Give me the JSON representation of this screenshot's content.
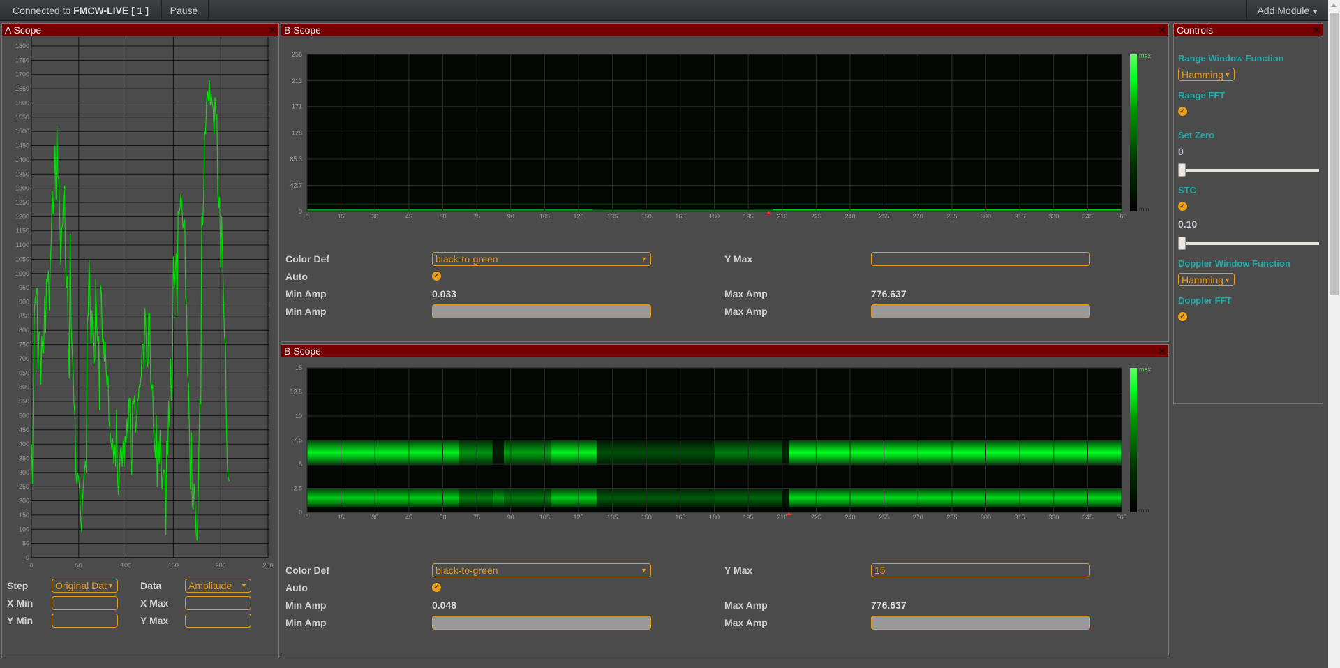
{
  "topbar": {
    "connected_prefix": "Connected to ",
    "device": "FMCW-LIVE [ 1 ]",
    "pause_label": "Pause",
    "add_module_label": "Add Module"
  },
  "colors": {
    "panel_header": "#760000",
    "accent": "#e89a16",
    "trace": "#00e000",
    "control_title": "#21a9a9"
  },
  "a_scope": {
    "title": "A Scope",
    "close_icon": "close-icon",
    "form": {
      "step_label": "Step",
      "step_value": "Original Dat",
      "data_label": "Data",
      "data_value": "Amplitude",
      "xmin_label": "X Min",
      "xmin_value": "",
      "xmax_label": "X Max",
      "xmax_value": "",
      "ymin_label": "Y Min",
      "ymin_value": "",
      "ymax_label": "Y Max",
      "ymax_value": ""
    }
  },
  "b_scope_1": {
    "title": "B Scope",
    "legend_max": "max",
    "legend_min": "min",
    "form": {
      "color_def_label": "Color Def",
      "color_def_value": "black-to-green",
      "y_max_label": "Y Max",
      "y_max_value": "",
      "auto_label": "Auto",
      "auto_checked": true,
      "min_amp_label": "Min Amp",
      "min_amp_value": "0.033",
      "max_amp_label": "Max Amp",
      "max_amp_value": "776.637",
      "min_amp_input_label": "Min Amp",
      "max_amp_input_label": "Max Amp"
    }
  },
  "b_scope_2": {
    "title": "B Scope",
    "legend_max": "max",
    "legend_min": "min",
    "form": {
      "color_def_label": "Color Def",
      "color_def_value": "black-to-green",
      "y_max_label": "Y Max",
      "y_max_value": "15",
      "auto_label": "Auto",
      "auto_checked": true,
      "min_amp_label": "Min Amp",
      "min_amp_value": "0.048",
      "max_amp_label": "Max Amp",
      "max_amp_value": "776.637",
      "min_amp_input_label": "Min Amp",
      "max_amp_input_label": "Max Amp"
    }
  },
  "controls": {
    "title": "Controls",
    "range_window_label": "Range Window Function",
    "range_window_value": "Hamming",
    "range_fft_label": "Range FFT",
    "range_fft_checked": true,
    "set_zero_label": "Set Zero",
    "set_zero_value": "0",
    "set_zero_fraction": 0.0,
    "stc_label": "STC",
    "stc_checked": true,
    "stc_value": "0.10",
    "stc_fraction": 0.0,
    "doppler_window_label": "Doppler Window Function",
    "doppler_window_value": "Hamming",
    "doppler_fft_label": "Doppler FFT",
    "doppler_fft_checked": true
  },
  "chart_data": [
    {
      "name": "a-scope",
      "type": "line",
      "title": "",
      "xlabel": "",
      "ylabel": "",
      "xlim": [
        0,
        250
      ],
      "ylim": [
        0,
        1800
      ],
      "x_ticks": [
        "0",
        "50",
        "100",
        "150",
        "200",
        "250"
      ],
      "y_ticks": [
        "0",
        "50",
        "100",
        "150",
        "200",
        "250",
        "300",
        "350",
        "400",
        "450",
        "500",
        "550",
        "600",
        "650",
        "700",
        "750",
        "800",
        "850",
        "900",
        "950",
        "1000",
        "1050",
        "1100",
        "1150",
        "1200",
        "1250",
        "1300",
        "1350",
        "1400",
        "1450",
        "1500",
        "1550",
        "1600",
        "1650",
        "1700",
        "1750",
        "1800"
      ],
      "grid": true,
      "series": [
        {
          "name": "Amplitude",
          "x": [
            0,
            1,
            2,
            3,
            4,
            5,
            6,
            7,
            8,
            9,
            10,
            11,
            12,
            13,
            14,
            15,
            16,
            17,
            18,
            19,
            20,
            21,
            22,
            23,
            24,
            25,
            26,
            27,
            28,
            29,
            30,
            31,
            32,
            33,
            34,
            35,
            36,
            37,
            38,
            39,
            40,
            41,
            42,
            43,
            44,
            45,
            46,
            47,
            48,
            49,
            50,
            51,
            52,
            53,
            54,
            55,
            56,
            57,
            58,
            59,
            60,
            61,
            62,
            63,
            64,
            65,
            66,
            67,
            68,
            69,
            70,
            71,
            72,
            73,
            74,
            75,
            76,
            77,
            78,
            79,
            80,
            81,
            82,
            83,
            84,
            85,
            86,
            87,
            88,
            89,
            90,
            91,
            92,
            93,
            94,
            95,
            96,
            97,
            98,
            99,
            100,
            101,
            102,
            103,
            104,
            105,
            106,
            107,
            108,
            109,
            110,
            111,
            112,
            113,
            114,
            115,
            116,
            117,
            118,
            119,
            120,
            121,
            122,
            123,
            124,
            125,
            126,
            127,
            128,
            129,
            130,
            131,
            132,
            133,
            134,
            135,
            136,
            137,
            138,
            139,
            140,
            141,
            142,
            143,
            144,
            145,
            146,
            147,
            148,
            149,
            150,
            151,
            152,
            153,
            154,
            155,
            156,
            157,
            158,
            159,
            160,
            161,
            162,
            163,
            164,
            165,
            166,
            167,
            168,
            169,
            170,
            171,
            172,
            173,
            174,
            175,
            176,
            177,
            178,
            179,
            180,
            181,
            182,
            183,
            184,
            185,
            186,
            187,
            188,
            189,
            190,
            191,
            192,
            193,
            194,
            195,
            196,
            197,
            198,
            199,
            200,
            201,
            202,
            203,
            204,
            205,
            206,
            207,
            208,
            209,
            210,
            211,
            212,
            213,
            214,
            215,
            216,
            217,
            218,
            219,
            220,
            221,
            222,
            223,
            224,
            225,
            226,
            227,
            228,
            229,
            230,
            231,
            232,
            233,
            234,
            235,
            236,
            237,
            238,
            239,
            240,
            241,
            242,
            243,
            244,
            245,
            246,
            247,
            248,
            249,
            250,
            251,
            252,
            253,
            254,
            255
          ],
          "y": [
            400,
            260,
            560,
            860,
            910,
            930,
            950,
            660,
            790,
            795,
            610,
            780,
            720,
            720,
            920,
            790,
            980,
            970,
            1010,
            870,
            1040,
            1120,
            1290,
            1210,
            1290,
            1450,
            1260,
            1520,
            1340,
            1330,
            1190,
            1030,
            1160,
            1170,
            1270,
            1310,
            1040,
            950,
            990,
            760,
            630,
            1140,
            820,
            730,
            670,
            540,
            500,
            300,
            260,
            300,
            280,
            230,
            150,
            90,
            200,
            260,
            300,
            340,
            300,
            820,
            860,
            1050,
            900,
            750,
            870,
            790,
            680,
            700,
            980,
            820,
            760,
            780,
            520,
            960,
            930,
            760,
            770,
            690,
            760,
            660,
            600,
            640,
            480,
            450,
            410,
            380,
            420,
            330,
            400,
            320,
            520,
            280,
            220,
            300,
            380,
            390,
            320,
            410,
            320,
            430,
            400,
            490,
            420,
            560,
            560,
            350,
            290,
            550,
            540,
            570,
            440,
            480,
            550,
            560,
            610,
            600,
            640,
            750,
            750,
            670,
            880,
            800,
            690,
            670,
            860,
            860,
            620,
            590,
            610,
            460,
            400,
            350,
            500,
            250,
            410,
            330,
            450,
            350,
            240,
            290,
            310,
            300,
            80,
            410,
            360,
            550,
            460,
            700,
            550,
            640,
            1060,
            950,
            1010,
            1070,
            850,
            1220,
            1210,
            1230,
            1280,
            1240,
            1160,
            1180,
            1190,
            920,
            880,
            650,
            610,
            440,
            240,
            440,
            180,
            170,
            260,
            190,
            90,
            60,
            170,
            400,
            560,
            540,
            1200,
            1170,
            1280,
            1500,
            1490,
            1600,
            1640,
            1610,
            1680,
            1590,
            1630,
            1600,
            1580,
            1490,
            1620,
            1540,
            1560,
            1280,
            1230,
            1270,
            1020,
            1200,
            1060,
            900,
            780,
            750,
            480,
            320,
            280,
            270
          ]
        }
      ]
    },
    {
      "name": "b-scope-range",
      "type": "heatmap",
      "title": "",
      "xlim": [
        0,
        360
      ],
      "ylim": [
        0,
        256
      ],
      "x_ticks": [
        "0",
        "15",
        "30",
        "45",
        "60",
        "75",
        "90",
        "105",
        "120",
        "135",
        "150",
        "165",
        "180",
        "195",
        "210",
        "225",
        "240",
        "255",
        "270",
        "285",
        "300",
        "315",
        "330",
        "345",
        "360"
      ],
      "y_ticks": [
        "0",
        "42.7",
        "85.3",
        "128",
        "171",
        "213",
        "256"
      ],
      "colormap": "black-to-green",
      "legend": [
        "max",
        "min"
      ],
      "marker_x": 204,
      "bands": [
        {
          "y": 3,
          "x_segments": [
            [
              0,
              126,
              0.7
            ],
            [
              126,
              206,
              0.2
            ],
            [
              206,
              360,
              0.95
            ]
          ]
        },
        {
          "y": 1,
          "x_segments": [
            [
              0,
              360,
              0.6
            ]
          ]
        },
        {
          "y": 12,
          "x_segments": [
            [
              0,
              360,
              0.15
            ]
          ]
        }
      ]
    },
    {
      "name": "b-scope-doppler",
      "type": "heatmap",
      "title": "",
      "xlim": [
        0,
        360
      ],
      "ylim": [
        0,
        15
      ],
      "x_ticks": [
        "0",
        "15",
        "30",
        "45",
        "60",
        "75",
        "90",
        "105",
        "120",
        "135",
        "150",
        "165",
        "180",
        "195",
        "210",
        "225",
        "240",
        "255",
        "270",
        "285",
        "300",
        "315",
        "330",
        "345",
        "360"
      ],
      "y_ticks": [
        "0",
        "2.5",
        "5",
        "7.5",
        "10",
        "12.5",
        "15"
      ],
      "colormap": "black-to-green",
      "legend": [
        "max",
        "min"
      ],
      "marker_x": 213,
      "bands": [
        {
          "y_center": 6.2,
          "y_halfwidth": 1.3,
          "x_segments": [
            [
              0,
              67,
              0.95
            ],
            [
              67,
              82,
              0.55
            ],
            [
              82,
              87,
              0.05
            ],
            [
              87,
              108,
              0.6
            ],
            [
              108,
              128,
              0.95
            ],
            [
              128,
              180,
              0.25
            ],
            [
              180,
              210,
              0.45
            ],
            [
              210,
              213,
              0.1
            ],
            [
              213,
              360,
              1.0
            ]
          ]
        },
        {
          "y_center": 1.5,
          "y_halfwidth": 1.0,
          "x_segments": [
            [
              0,
              67,
              0.8
            ],
            [
              67,
              82,
              0.45
            ],
            [
              82,
              87,
              0.6
            ],
            [
              87,
              108,
              0.45
            ],
            [
              108,
              128,
              0.8
            ],
            [
              128,
              180,
              0.3
            ],
            [
              180,
              210,
              0.35
            ],
            [
              210,
              213,
              0.05
            ],
            [
              213,
              360,
              0.85
            ]
          ]
        }
      ]
    }
  ]
}
